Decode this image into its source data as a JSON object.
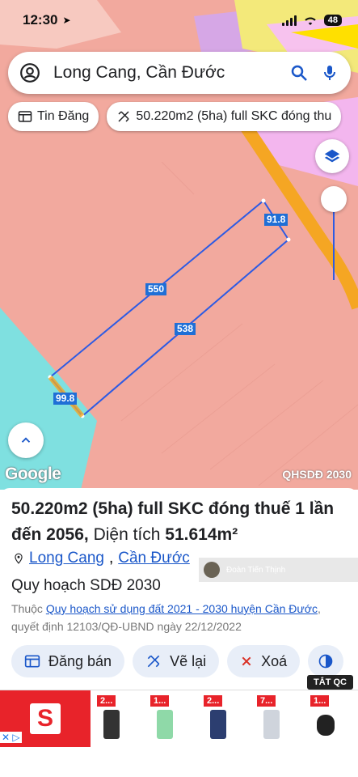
{
  "status_bar": {
    "time": "12:30",
    "battery": "48"
  },
  "search": {
    "query": "Long Cang, Cần Đước"
  },
  "chips": [
    {
      "label": "Tin Đăng"
    },
    {
      "label": "50.220m2 (5ha) full SKC đóng thu"
    }
  ],
  "map": {
    "edge_labels": [
      "550",
      "538",
      "91.8",
      "99.8"
    ],
    "google": "Google",
    "layer_name": "QHSDĐ 2030"
  },
  "listing": {
    "title": "50.220m2 (5ha) full SKC đóng thuế 1 lần đến 2056,",
    "area_label": "Diện tích",
    "area_value": "51.614m²",
    "location_ward": "Long Cang",
    "location_sep": ",",
    "location_district": "Cần Đước",
    "plan": "Quy hoạch SDĐ 2030",
    "belongs_prefix": "Thuộc",
    "plan_link": "Quy hoạch sử dụng đất 2021 - 2030 huyện Cần Đước",
    "decision": ", quyết định 12103/QĐ-UBND ngày 22/12/2022",
    "overlay_name": "Đoàn Tiến Thịnh"
  },
  "actions": [
    {
      "label": "Đăng bán",
      "icon": "listing-icon"
    },
    {
      "label": "Vẽ lại",
      "icon": "draw-icon"
    },
    {
      "label": "Xoá",
      "icon": "close-icon"
    }
  ],
  "ad": {
    "tag": "TẮT QC",
    "products": [
      "2...",
      "1...",
      "2...",
      "7...",
      "1..."
    ]
  },
  "colors": {
    "land_red": "#f2a99e",
    "river": "#7fe0e0",
    "road": "#f5a623",
    "accent": "#1a57c9"
  }
}
